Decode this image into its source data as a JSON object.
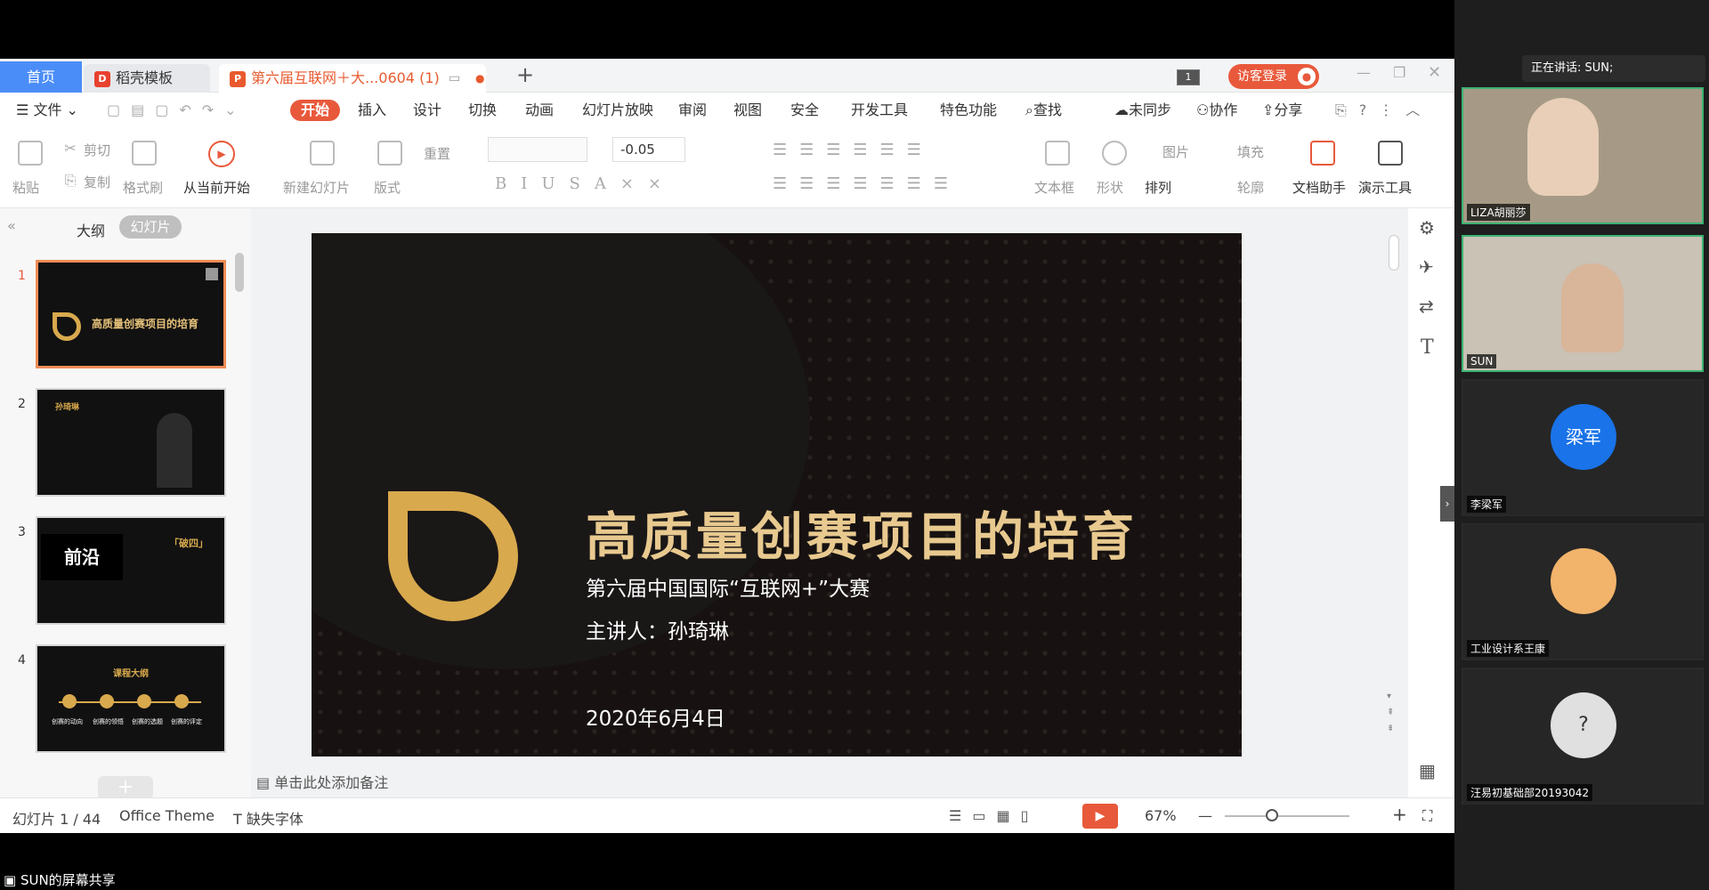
{
  "tabs": {
    "home": "首页",
    "template": "稻壳模板",
    "doc": "第六届互联网＋大...0604 (1)",
    "login": "访客登录"
  },
  "menu": {
    "file": "文件",
    "start": "开始",
    "insert": "插入",
    "design": "设计",
    "transition": "切换",
    "animation": "动画",
    "slideshow": "幻灯片放映",
    "review": "审阅",
    "view": "视图",
    "security": "安全",
    "devtools": "开发工具",
    "special": "特色功能",
    "find": "查找",
    "unsync": "未同步",
    "collab": "协作",
    "share": "分享"
  },
  "ribbon": {
    "paste": "粘贴",
    "cut": "剪切",
    "copy": "复制",
    "format_brush": "格式刷",
    "from_current": "从当前开始",
    "new_slide": "新建幻灯片",
    "layout": "版式",
    "reset": "重置",
    "font_size": "-0.05",
    "text_box": "文本框",
    "shape": "形状",
    "arrange": "排列",
    "picture": "图片",
    "fill": "填充",
    "outline": "轮廓",
    "doc_helper": "文档助手",
    "presenter": "演示工具"
  },
  "panel": {
    "outline": "大纲",
    "slides": "幻灯片",
    "nums": [
      "1",
      "2",
      "3",
      "4"
    ]
  },
  "thumbs": {
    "t1_title": "高质量创赛项目的培育",
    "t2_name": "孙琦琳",
    "t3_word": "前沿",
    "t3_tag": "「破四」",
    "t4_title": "课程大纲",
    "t4_items": [
      "创赛的动向",
      "创赛的领悟",
      "创赛的选题",
      "创赛的评定"
    ]
  },
  "slide": {
    "title": "高质量创赛项目的培育",
    "subtitle": "第六届中国国际“互联网+”大赛",
    "presenter": "主讲人：孙琦琳",
    "date": "2020年6月4日"
  },
  "notes": "单击此处添加备注",
  "status": {
    "slide_count": "幻灯片 1 / 44",
    "theme": "Office Theme",
    "missing_font": "缺失字体",
    "zoom": "67%"
  },
  "meeting": {
    "speaking": "正在讲话: SUN;",
    "participants": [
      "LIZA胡丽莎",
      "SUN",
      "李梁军",
      "工业设计系王康",
      "汪易初基础部20193042"
    ],
    "avatar_text": "梁军",
    "share_label": "SUN的屏幕共享"
  },
  "colors": {
    "accent": "#e8593b",
    "blue": "#4b8df8",
    "gold": "#d8a94d",
    "avatar": "#1a73e8"
  }
}
